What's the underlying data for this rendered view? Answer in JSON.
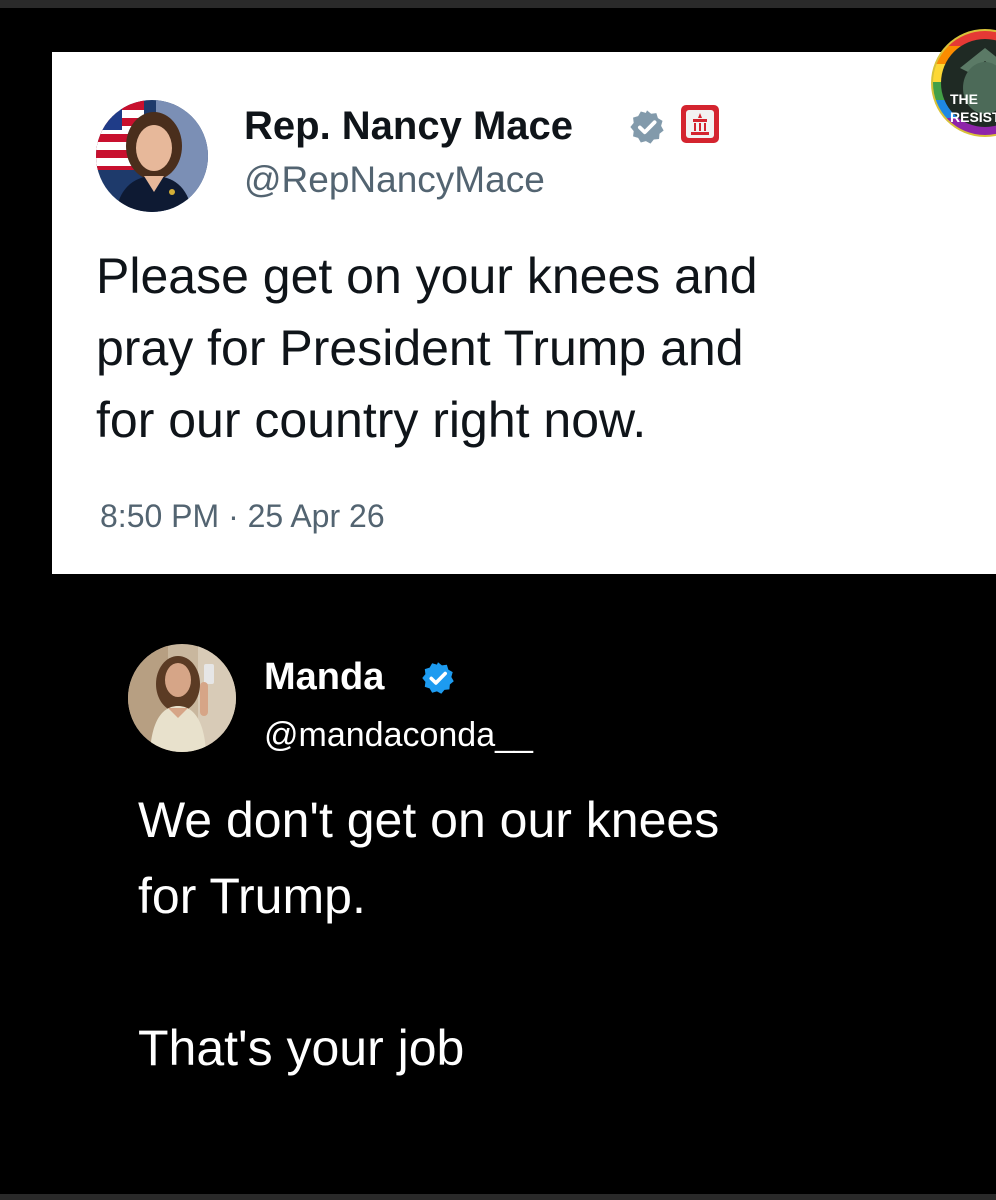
{
  "tweet_original": {
    "author_name": "Rep. Nancy Mace",
    "author_handle": "@RepNancyMace",
    "text": "Please get on your knees and\npray for President Trump and\nfor our country right now.",
    "timestamp": "8:50 PM · 25 Apr 26",
    "verified_icon": "verified-badge-icon",
    "affiliation_icon": "government-badge-icon",
    "card_color": "#ffffff",
    "text_color": "#0f1419",
    "muted_color": "#536471"
  },
  "tweet_reply": {
    "author_name": "Manda",
    "author_handle": "@mandaconda__",
    "text": "We don't get on our knees\nfor Trump.\n\nThat's your job",
    "verified_icon": "verified-badge-icon",
    "text_color": "#ffffff"
  },
  "watermark": {
    "text": "THE RESISTANCE",
    "icon": "resistance-logo-icon"
  },
  "colors": {
    "background": "#000000",
    "verified_blue": "#1d9bf0",
    "verified_gray": "#829aab",
    "gov_red": "#d4242f"
  }
}
